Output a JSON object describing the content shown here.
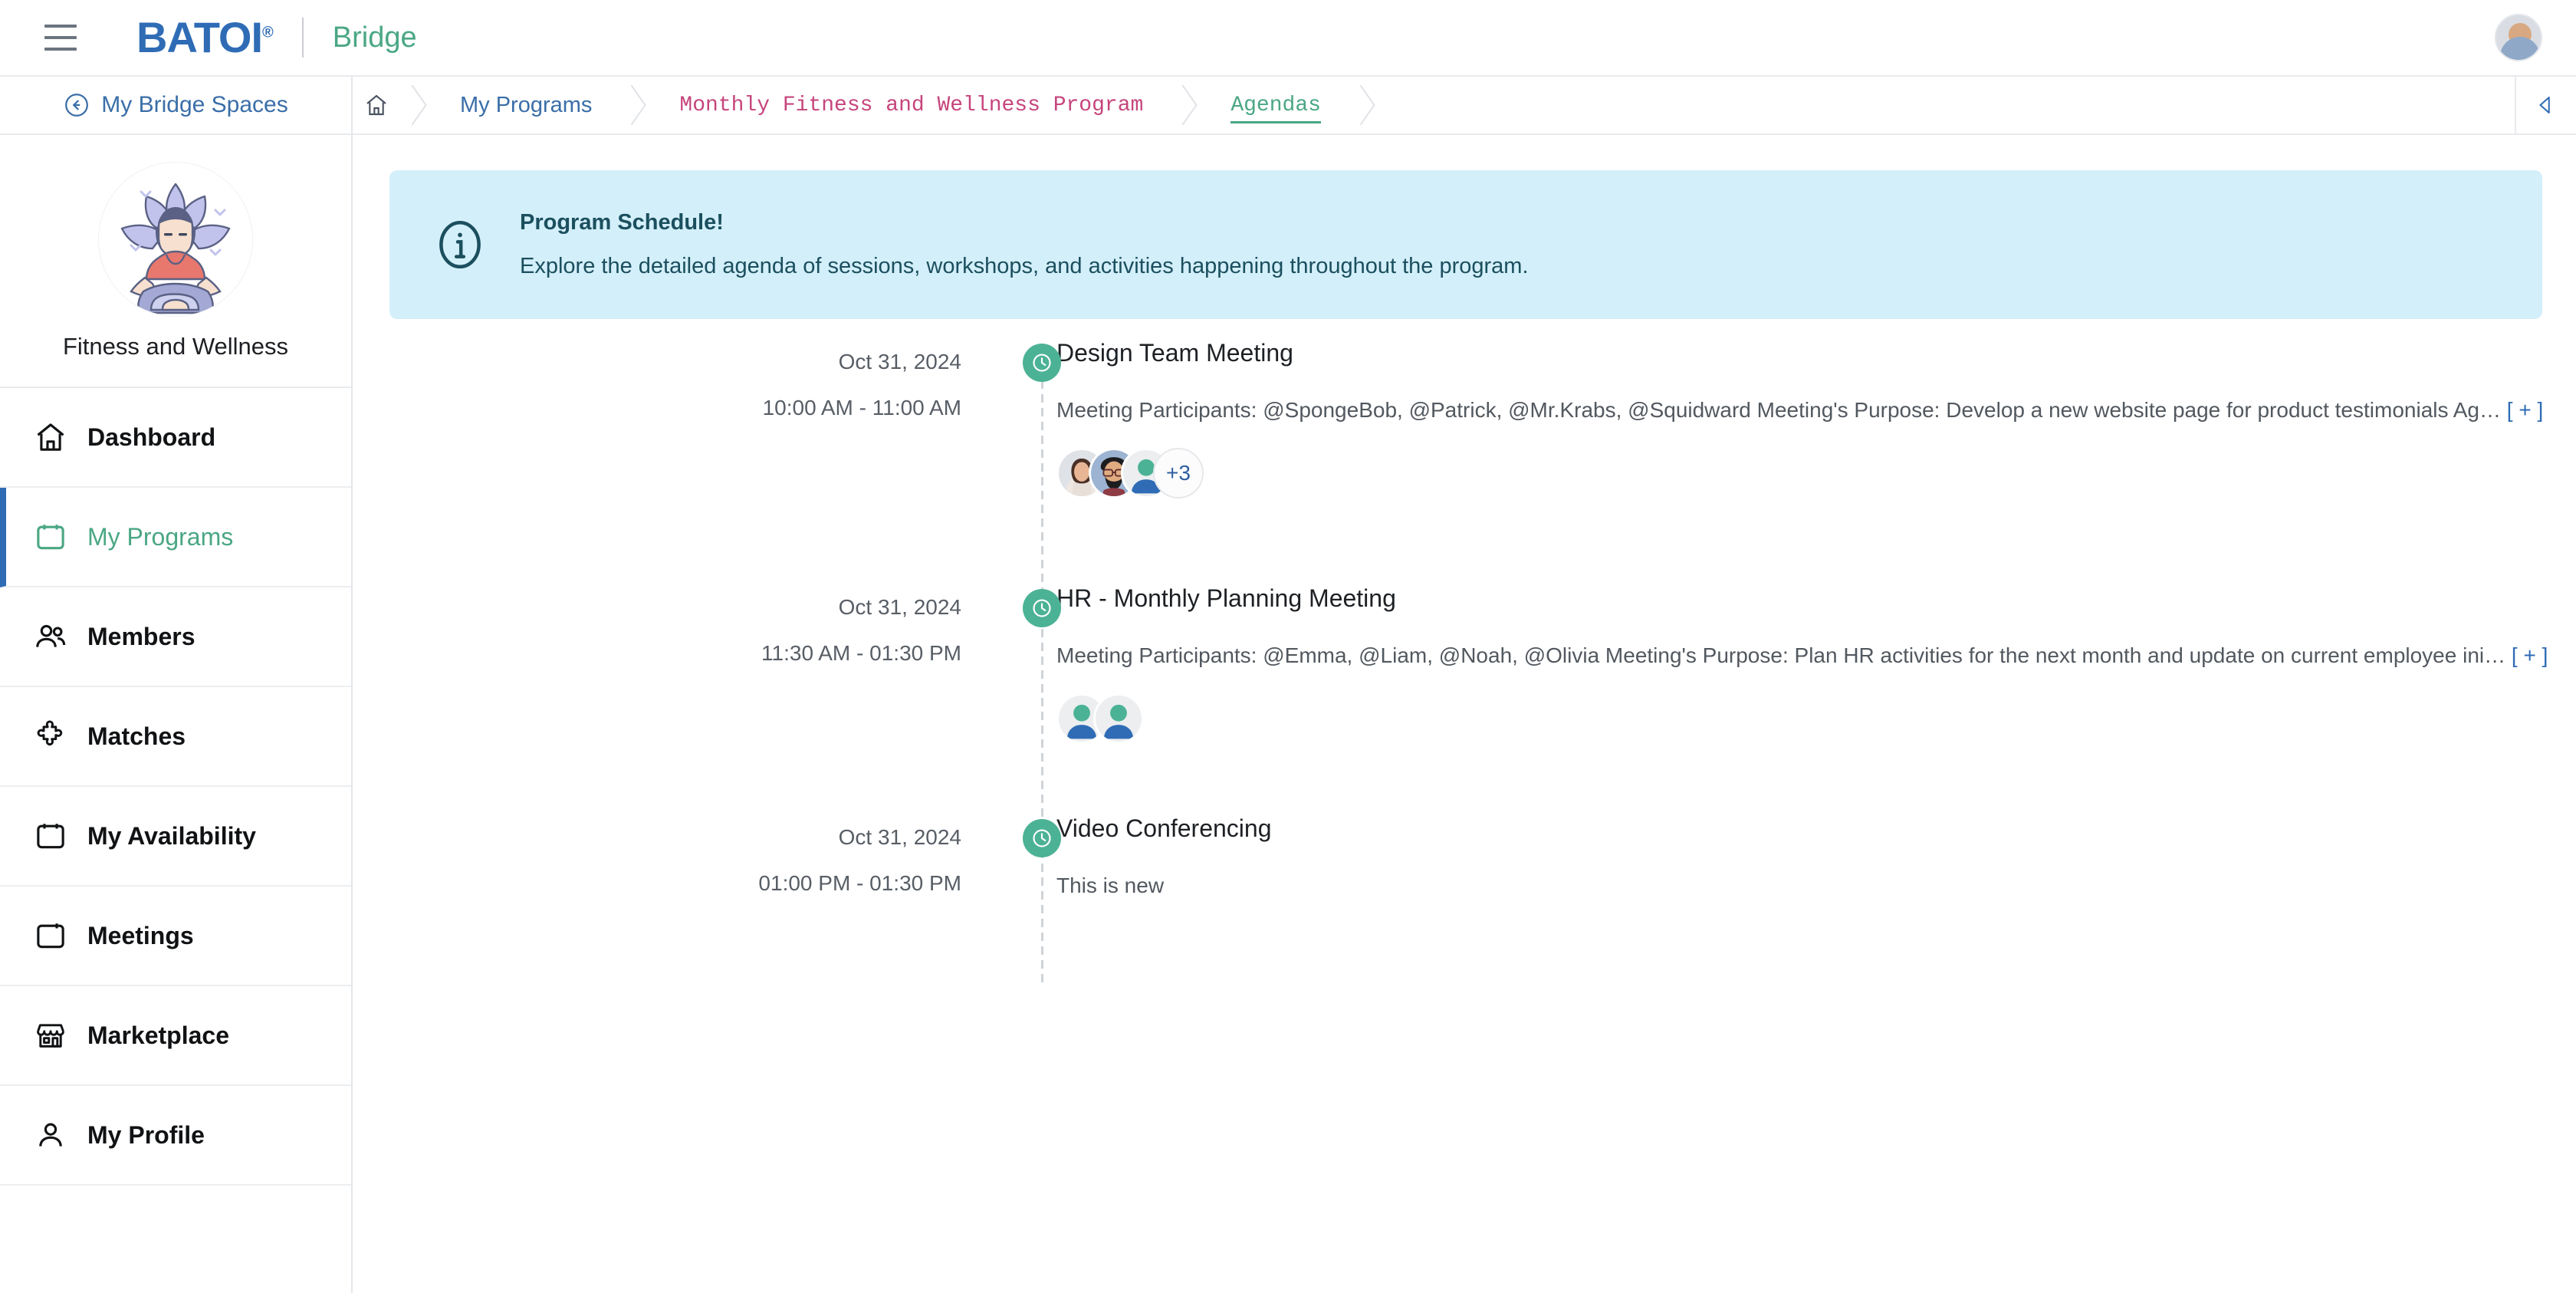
{
  "topbar": {
    "menu_icon": "hamburger-icon",
    "logo_text": "BATOI",
    "logo_registered": "®",
    "product_name": "Bridge",
    "avatar_icon": "user-avatar"
  },
  "breadcrumb": {
    "home_icon": "home-icon",
    "items": [
      {
        "label": "My Programs",
        "style": "blue"
      },
      {
        "label": "Monthly Fitness and Wellness Program",
        "style": "pink"
      },
      {
        "label": "Agendas",
        "style": "green-active"
      }
    ],
    "collapse_icon": "chevron-left-icon"
  },
  "sidebar": {
    "back_label": "My Bridge Spaces",
    "back_icon": "arrow-left-circle-icon",
    "space_name": "Fitness and Wellness",
    "space_avatar_icon": "yoga-lotus-avatar",
    "items": [
      {
        "label": "Dashboard",
        "icon": "home-icon",
        "active": false
      },
      {
        "label": "My Programs",
        "icon": "calendar-icon",
        "active": true
      },
      {
        "label": "Members",
        "icon": "users-icon",
        "active": false
      },
      {
        "label": "Matches",
        "icon": "puzzle-icon",
        "active": false
      },
      {
        "label": "My Availability",
        "icon": "calendar-icon",
        "active": false
      },
      {
        "label": "Meetings",
        "icon": "calendar-icon",
        "active": false
      },
      {
        "label": "Marketplace",
        "icon": "store-icon",
        "active": false
      },
      {
        "label": "My Profile",
        "icon": "person-icon",
        "active": false
      }
    ]
  },
  "notice": {
    "icon": "info-circle-icon",
    "title": "Program Schedule!",
    "body": "Explore the detailed agenda of sessions, workshops, and activities happening throughout the program."
  },
  "agenda": {
    "entries": [
      {
        "date": "Oct 31, 2024",
        "time": "10:00 AM - 11:00 AM",
        "marker_icon": "clock-icon",
        "title": "Design Team Meeting",
        "description": "Meeting Participants: @SpongeBob, @Patrick, @Mr.Krabs, @Squidward Meeting's Purpose: Develop a new website page for product testimonials Ag…",
        "expand_label": "[ + ]",
        "extra_count": "+3"
      },
      {
        "date": "Oct 31, 2024",
        "time": "11:30 AM - 01:30 PM",
        "marker_icon": "clock-icon",
        "title": "HR - Monthly Planning Meeting",
        "description": "Meeting Participants: @Emma, @Liam, @Noah, @Olivia Meeting's Purpose: Plan HR activities for the next month and update on current employee ini…",
        "expand_label": "[ + ]"
      },
      {
        "date": "Oct 31, 2024",
        "time": "01:00 PM - 01:30 PM",
        "marker_icon": "clock-icon",
        "title": "Video Conferencing",
        "description": "This is new"
      }
    ]
  },
  "colors": {
    "brand_blue": "#2f6cb5",
    "brand_green": "#4aa784",
    "accent_pink": "#c6457c",
    "marker_green": "#4cb295",
    "notice_bg": "#d3effa",
    "notice_text": "#1b4f5e",
    "link_blue": "#2f6cb5"
  }
}
